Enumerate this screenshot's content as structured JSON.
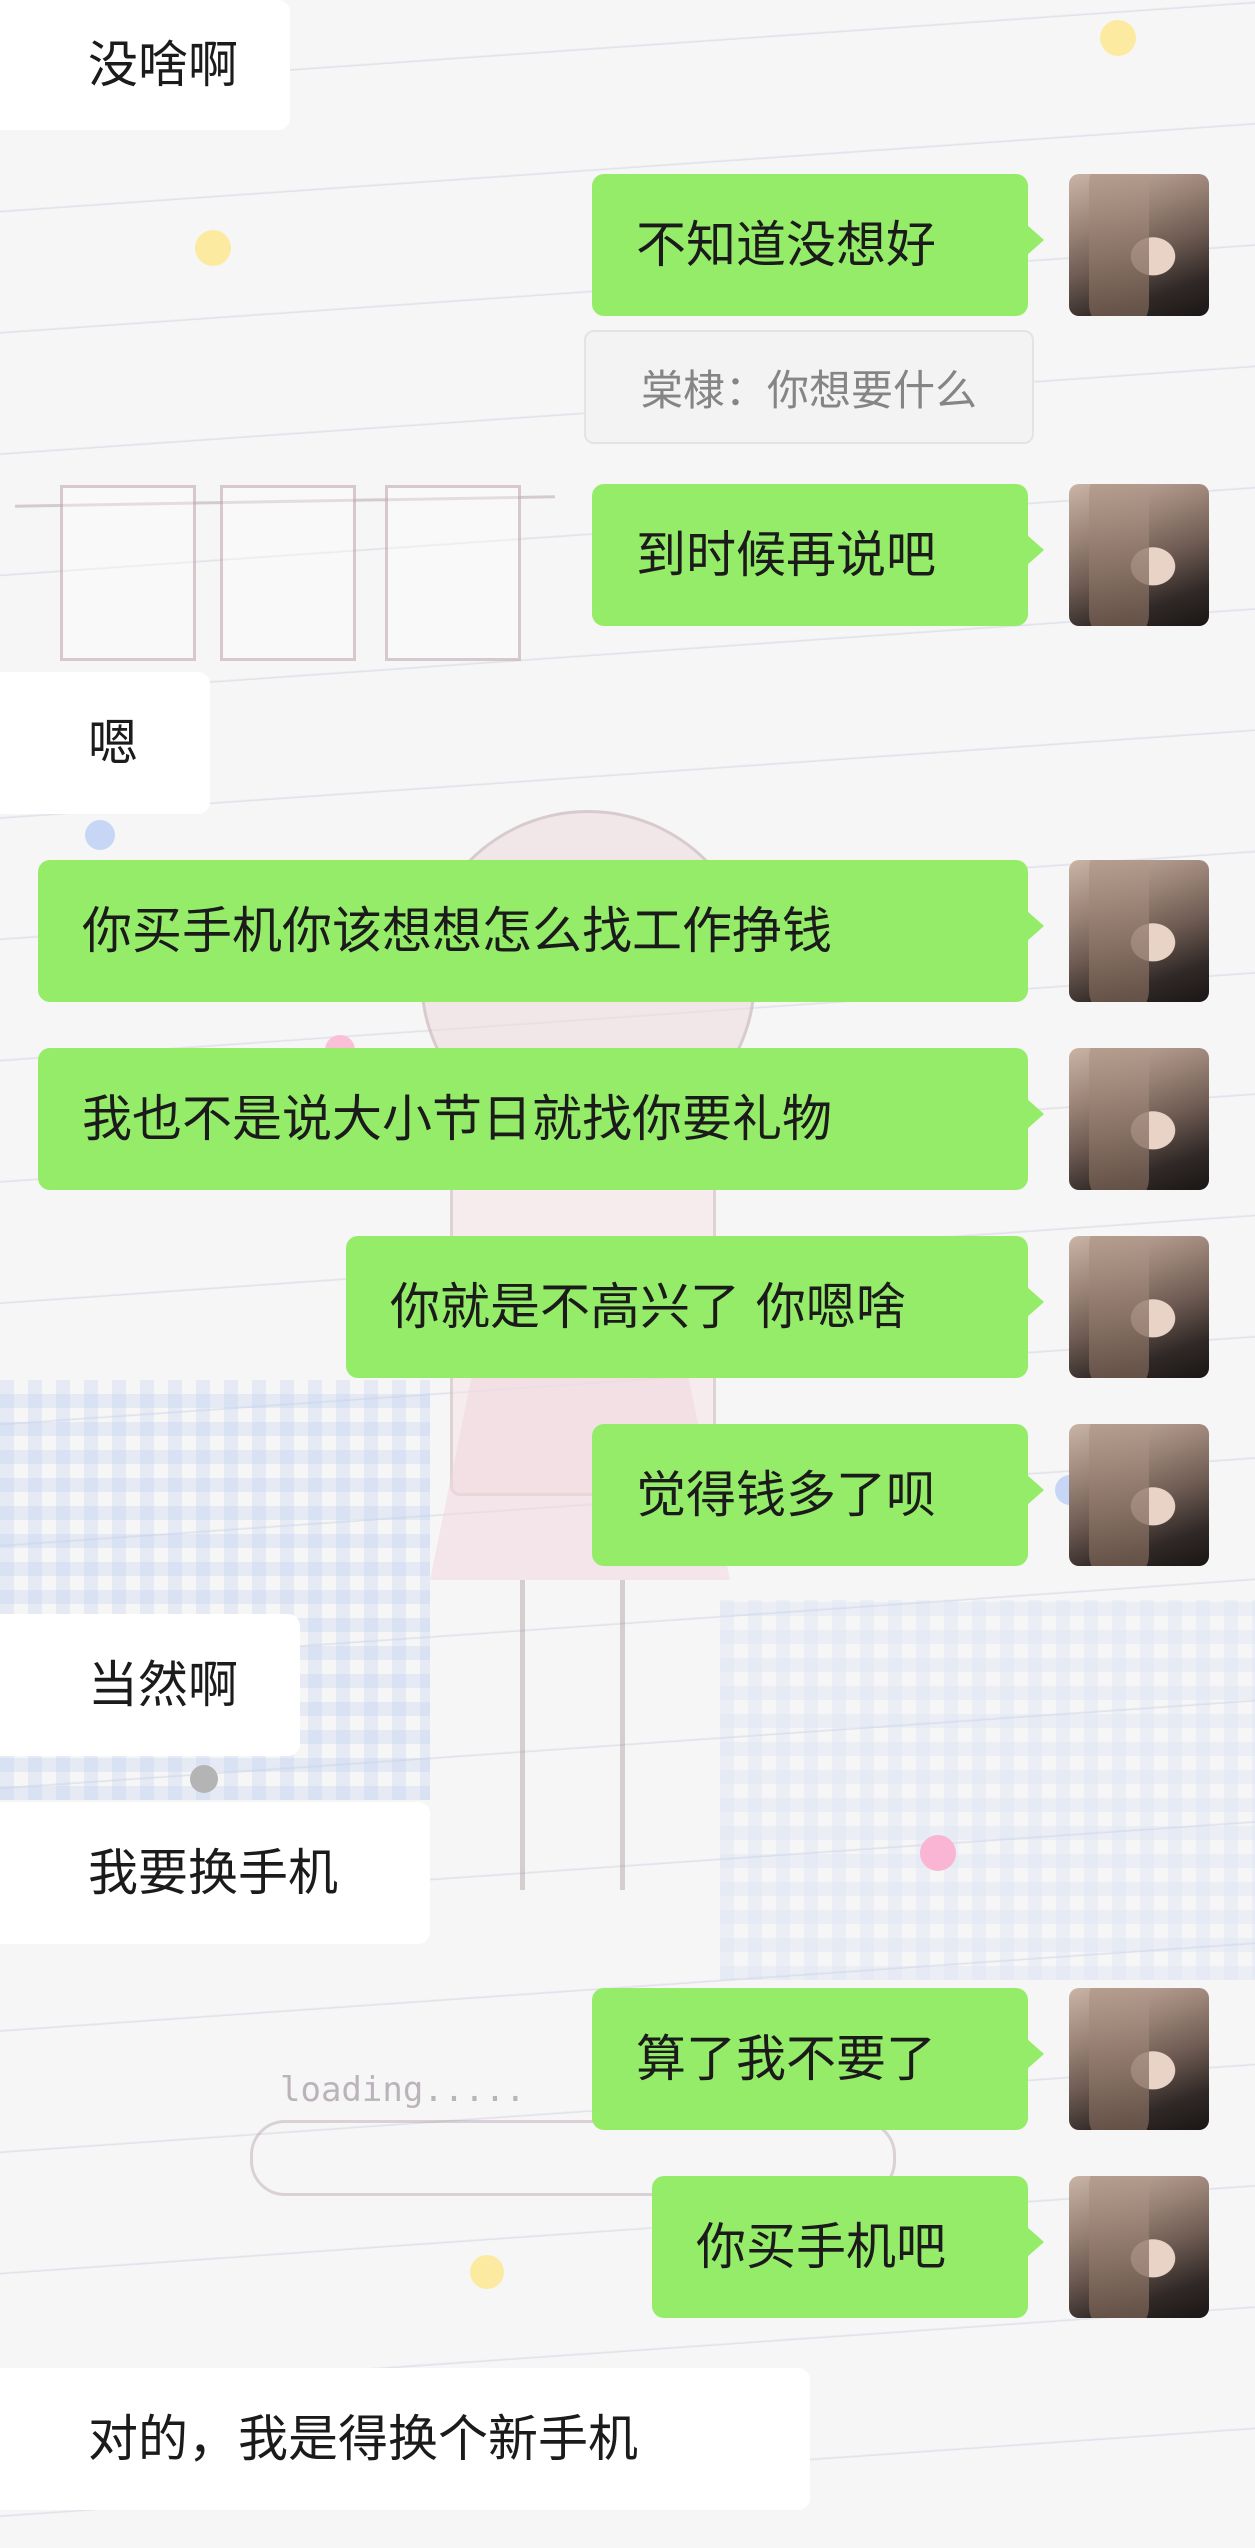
{
  "messages": [
    {
      "dir": "in",
      "text": "没啥啊"
    },
    {
      "dir": "out",
      "text": "不知道没想好"
    },
    {
      "dir": "system",
      "text": "棠棣：你想要什么"
    },
    {
      "dir": "out",
      "text": "到时候再说吧"
    },
    {
      "dir": "in",
      "text": "嗯"
    },
    {
      "dir": "out",
      "text": "你买手机你该想想怎么找工作挣钱"
    },
    {
      "dir": "out",
      "text": "我也不是说大小节日就找你要礼物"
    },
    {
      "dir": "out",
      "text": "你就是不高兴了 你嗯啥"
    },
    {
      "dir": "out",
      "text": "觉得钱多了呗"
    },
    {
      "dir": "in",
      "text": "当然啊"
    },
    {
      "dir": "in",
      "text": "我要换手机"
    },
    {
      "dir": "out",
      "text": "算了我不要了"
    },
    {
      "dir": "out",
      "text": "你买手机吧"
    },
    {
      "dir": "in",
      "text": "对的，我是得换个新手机"
    }
  ],
  "colors": {
    "outgoing_bubble": "#95ec69",
    "incoming_bubble": "#ffffff",
    "system_tip_text": "#858585"
  },
  "wallpaper": {
    "text_loading": "loading....."
  }
}
